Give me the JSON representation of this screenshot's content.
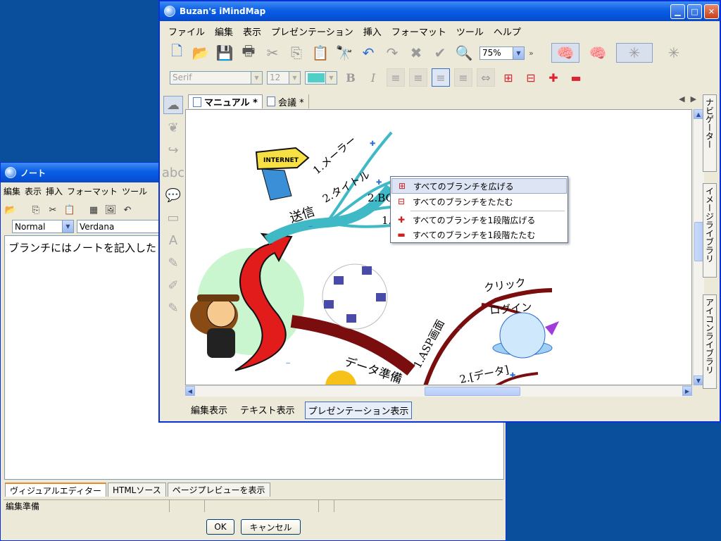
{
  "note_window": {
    "title": "ノート",
    "menu": [
      "編集",
      "表示",
      "挿入",
      "フォーマット",
      "ツール"
    ],
    "style_value": "Normal",
    "font_value": "Verdana",
    "content": "ブランチにはノートを記入した",
    "tabs": [
      "ヴィジュアルエディター",
      "HTMLソース",
      "ページプレビューを表示"
    ],
    "status_text": "編集準備",
    "ok_label": "OK",
    "cancel_label": "キャンセル"
  },
  "main_window": {
    "title": "Buzan's iMindMap",
    "menu": [
      "ファイル",
      "編集",
      "表示",
      "プレゼンテーション",
      "挿入",
      "フォーマット",
      "ツール",
      "ヘルプ"
    ],
    "zoom": "75%",
    "font_family": "Serif",
    "font_size": "12",
    "doc_tabs": [
      "マニュアル *",
      "会議 *"
    ],
    "right_tabs": [
      "ナビゲーター",
      "イメージライブラリ",
      "アイコンライブラリ"
    ],
    "modes": [
      "編集表示",
      "テキスト表示",
      "プレゼンテーション表示"
    ],
    "active_mode": 2,
    "fill_color": "#4fcfc8"
  },
  "mindmap": {
    "branches": [
      "送信",
      "データ準備"
    ],
    "send_children": [
      "1.メーラー",
      "2.タイトル",
      "2.BC",
      "1."
    ],
    "prep_children": [
      "1.ASP画面",
      "クリック",
      "ログイン",
      "2.[データ]"
    ],
    "image_labels": [
      "INTERNET"
    ],
    "colors": {
      "send_branch": "#3fb9c6",
      "prep_branch": "#7a0d0d",
      "arrow": "#e21b1b",
      "center_bg": "#c9f5cf"
    }
  },
  "context_menu": {
    "items": [
      "すべてのブランチを広げる",
      "すべてのブランチをたたむ",
      "すべてのブランチを1段階広げる",
      "すべてのブランチを1段階たたむ"
    ]
  }
}
